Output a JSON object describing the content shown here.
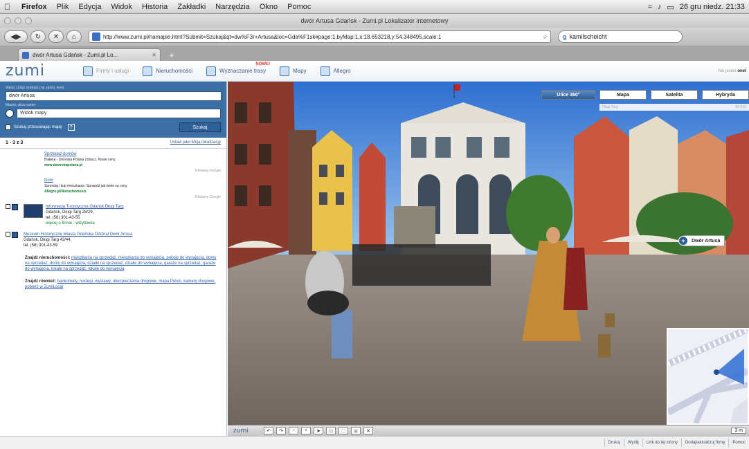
{
  "os_menu": {
    "apple": "",
    "items": [
      "Firefox",
      "Plik",
      "Edycja",
      "Widok",
      "Historia",
      "Zakładki",
      "Narzędzia",
      "Okno",
      "Pomoc"
    ],
    "clock": "26 gru niedz. 21:33"
  },
  "window": {
    "title": "dwór Artusa Gdańsk - Zumi.pl Lokalizator internetowy"
  },
  "toolbar": {
    "url": "http://www.zumi.pl/namapie.html?Submit=Szukaj&qt=dw%F3r+Artusa&loc=Gda%F1sk#page:1,byMap:1,x:18.653218,y:54.348495,scale:1",
    "search_value": "kamilscheicht"
  },
  "tab": {
    "label": "dwór Artusa Gdańsk - Zumi.pl Lo..."
  },
  "site_header": {
    "logo": "zumi",
    "nav": [
      {
        "label": "Firmy i usługi"
      },
      {
        "label": "Nieruchomości"
      },
      {
        "label": "Wyznaczanie trasy",
        "badge": "NOWE!"
      },
      {
        "label": "Mapy"
      },
      {
        "label": "Allegro"
      }
    ],
    "right_text_prefix": "Nie jesteś ",
    "right_text_user": "onet"
  },
  "search_form": {
    "what_label": "Wpisz czego szukasz (np. pizza, kino)",
    "what_value": "dwór Artusa",
    "where_label": "Miasto, ulica numer",
    "where_value": "Widok mapy",
    "move_map_label": "Szukaj przesuwając mapę",
    "help": "?",
    "submit": "Szukaj"
  },
  "results": {
    "count": "1 - 3 z 3",
    "show_link": "Ustaw jako Moją lokalizację",
    "ads": [
      {
        "title": "Sprzedaż domów",
        "desc": "Białęka - Dworska Polana Zobacz. Nowe ceny",
        "url": "www.dworskapolana.pl",
        "source": "Reklamy Google"
      },
      {
        "title": "Dom",
        "desc": "Sprzedaj i kup mieszkanie. Sprawdź jak wiele są ceny.",
        "url": "Allegro.pl/Nieruchomosci",
        "source": "Reklamy Google"
      }
    ],
    "items": [
      {
        "title": "Informacja Turystyczna Gdańsk Długi Targ",
        "addr": "Gdańsk, Długi Targ 28/29,",
        "tel": "tel. (58) 301-43-55",
        "extra": "więcej o firmie - wizytówka"
      },
      {
        "title": "Muzeum Historyczne Miasta Gdańska Oddział Dwór Artusa",
        "addr": "Gdańsk, Długi Targ 43/44,",
        "tel": "tel. (58) 301-43-59",
        "extra": ""
      }
    ]
  },
  "more": {
    "realestate_label": "Znajdź nieruchomości:",
    "realestate_links": "mieszkania na sprzedaż, mieszkania do wynajęcia, pokoje do wynajęcia, domy na sprzedaż, domy do wynajęcia, działki na sprzedaż, działki do wynajęcia, garaże na sprzedaż, garaże do wynajęcia, lokale na sprzedaż, lokale do wynajęcia",
    "also_label": "Znajdź również:",
    "also_links": "bankomaty, noclegi, wystawy, ubezpieczenia drogowe, mapa Polski, kamery drogowe, pobierz w ZumiLocal"
  },
  "map": {
    "view_tabs": [
      "Ulice 360°",
      "Mapa",
      "Satelita",
      "Hybryda"
    ],
    "active_view": "Ulice 360°",
    "address_left": "Długi Targ",
    "address_right": "80-830",
    "poi_label": "Dwór Artusa",
    "logo": "zumi",
    "zoom_label": "3 m"
  },
  "footer_links": [
    "Drukuj",
    "Wyślij",
    "Link do tej strony",
    "Dodaj/aktualizuj firmę",
    "Pomoc"
  ]
}
